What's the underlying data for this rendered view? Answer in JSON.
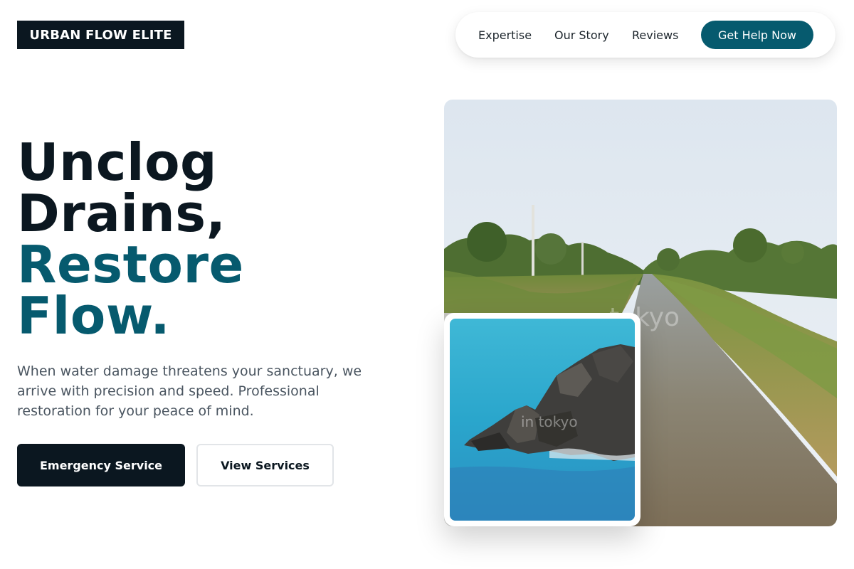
{
  "brand": {
    "logo_text": "URBAN FLOW ELITE"
  },
  "nav": {
    "links": [
      "Expertise",
      "Our Story",
      "Reviews"
    ],
    "cta_label": "Get Help Now"
  },
  "hero": {
    "headline_line1": "Unclog",
    "headline_line2": "Drains,",
    "headline_line3": "Restore",
    "headline_line4": "Flow.",
    "subtext": "When water damage threatens your sanctuary, we arrive with precision and speed. Professional restoration for your peace of mind.",
    "primary_button": "Emergency Service",
    "secondary_button": "View Services"
  },
  "images": {
    "main_watermark": "tokyo",
    "inset_watermark": "in tokyo"
  },
  "colors": {
    "dark": "#0b1720",
    "accent": "#065a6e",
    "body_text": "#4a5560"
  }
}
